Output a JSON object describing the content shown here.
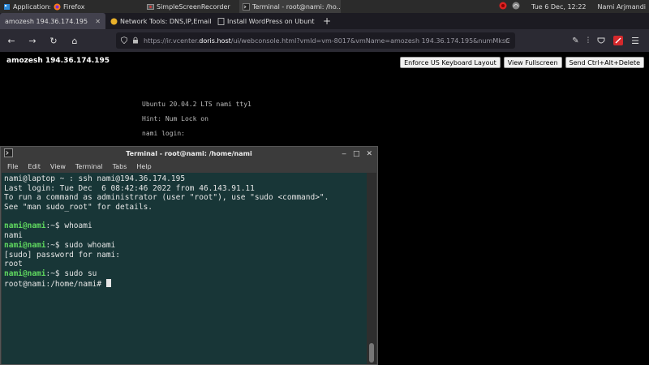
{
  "panel": {
    "tasks": [
      {
        "label": "Applications",
        "icon": "applications-menu-icon"
      },
      {
        "label": "Firefox",
        "icon": "firefox-icon"
      },
      {
        "label": "SimpleScreenRecorder",
        "icon": "screen-recorder-icon"
      },
      {
        "label": "Terminal - root@nami: /ho...",
        "icon": "terminal-icon"
      }
    ],
    "clock": "Tue 6 Dec, 12:22",
    "user": "Nami Arjmandi"
  },
  "firefox": {
    "tabs": [
      {
        "label": "amozesh 194.36.174.195",
        "active": true
      },
      {
        "label": "Network Tools: DNS,IP,Email",
        "active": false
      },
      {
        "label": "Install WordPress on Ubunt",
        "active": false
      }
    ],
    "new_tab_label": "+",
    "url_prefix": "https://ir.vcenter.",
    "url_host": "doris.host",
    "url_suffix": "/ui/webconsole.html?vmId=vm-8017&vmName=amozesh 194.36.174.195&numMksC"
  },
  "console": {
    "vm_title": "amozesh 194.36.174.195",
    "buttons": [
      "Enforce US Keyboard Layout",
      "View Fullscreen",
      "Send Ctrl+Alt+Delete"
    ],
    "lines": [
      "Ubuntu 20.04.2 LTS nami tty1",
      "Hint: Num Lock on",
      "nami login:"
    ]
  },
  "terminal": {
    "title": "Terminal - root@nami: /home/nami",
    "menu": [
      "File",
      "Edit",
      "View",
      "Terminal",
      "Tabs",
      "Help"
    ],
    "lines": [
      {
        "prompt": "",
        "text": "nami@laptop ~ : ssh nami@194.36.174.195"
      },
      {
        "prompt": "",
        "text": "Last login: Tue Dec  6 08:42:46 2022 from 46.143.91.11"
      },
      {
        "prompt": "",
        "text": "To run a command as administrator (user \"root\"), use \"sudo <command>\"."
      },
      {
        "prompt": "",
        "text": "See \"man sudo_root\" for details."
      },
      {
        "prompt": "",
        "text": ""
      },
      {
        "prompt": "nami@nami",
        "text": ":~$ whoami"
      },
      {
        "prompt": "",
        "text": "nami"
      },
      {
        "prompt": "nami@nami",
        "text": ":~$ sudo whoami"
      },
      {
        "prompt": "",
        "text": "[sudo] password for nami:"
      },
      {
        "prompt": "",
        "text": "root"
      },
      {
        "prompt": "nami@nami",
        "text": ":~$ sudo su"
      },
      {
        "prompt": "",
        "text": "root@nami:/home/nami# "
      }
    ]
  }
}
